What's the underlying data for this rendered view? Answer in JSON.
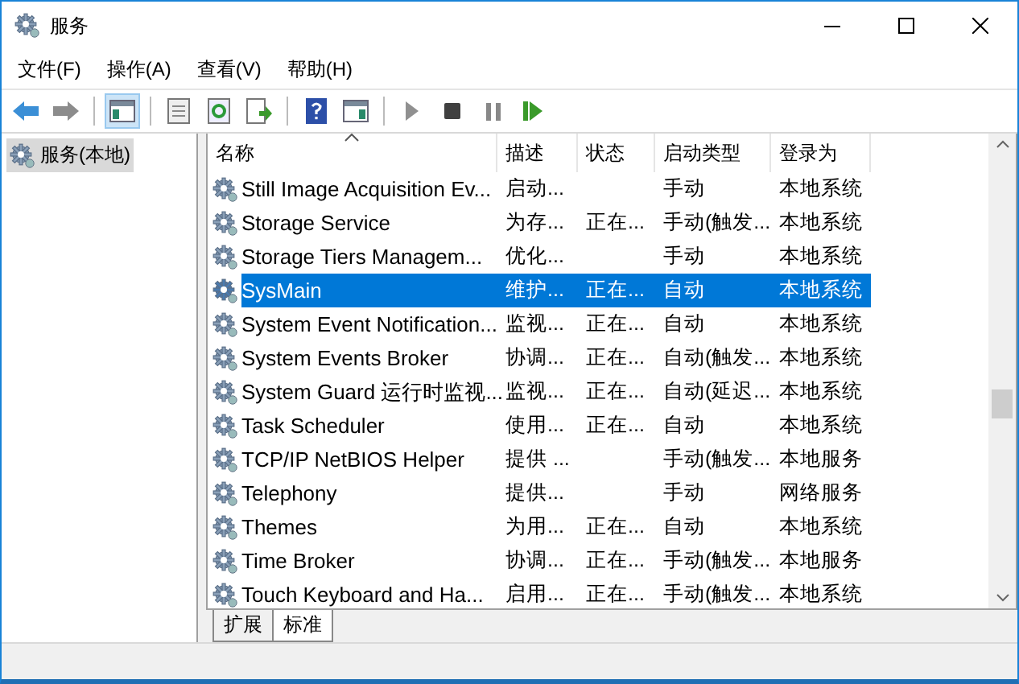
{
  "window": {
    "title": "服务"
  },
  "menu": [
    "文件(F)",
    "操作(A)",
    "查看(V)",
    "帮助(H)"
  ],
  "toolbar": [
    {
      "kind": "back",
      "pressed": false
    },
    {
      "kind": "forward",
      "pressed": false
    },
    {
      "kind": "sep"
    },
    {
      "kind": "tree",
      "pressed": true
    },
    {
      "kind": "sep"
    },
    {
      "kind": "properties",
      "pressed": false
    },
    {
      "kind": "refresh",
      "pressed": false
    },
    {
      "kind": "export",
      "pressed": false
    },
    {
      "kind": "sep"
    },
    {
      "kind": "help",
      "pressed": false
    },
    {
      "kind": "pane",
      "pressed": false
    },
    {
      "kind": "sep"
    },
    {
      "kind": "play",
      "pressed": false
    },
    {
      "kind": "stop",
      "pressed": false
    },
    {
      "kind": "pause",
      "pressed": false
    },
    {
      "kind": "resume",
      "pressed": false
    }
  ],
  "sidebar": {
    "items": [
      {
        "label": "服务(本地)",
        "selected": true
      }
    ]
  },
  "table": {
    "columns": [
      "名称",
      "描述",
      "状态",
      "启动类型",
      "登录为"
    ],
    "rows": [
      {
        "name": "Still Image Acquisition Ev...",
        "description": "启动...",
        "status": "",
        "startup": "手动",
        "logon": "本地系统",
        "selected": false
      },
      {
        "name": "Storage Service",
        "description": "为存...",
        "status": "正在...",
        "startup": "手动(触发...",
        "logon": "本地系统",
        "selected": false
      },
      {
        "name": "Storage Tiers Managem...",
        "description": "优化...",
        "status": "",
        "startup": "手动",
        "logon": "本地系统",
        "selected": false
      },
      {
        "name": "SysMain",
        "description": "维护...",
        "status": "正在...",
        "startup": "自动",
        "logon": "本地系统",
        "selected": true
      },
      {
        "name": "System Event Notification...",
        "description": "监视...",
        "status": "正在...",
        "startup": "自动",
        "logon": "本地系统",
        "selected": false
      },
      {
        "name": "System Events Broker",
        "description": "协调...",
        "status": "正在...",
        "startup": "自动(触发...",
        "logon": "本地系统",
        "selected": false
      },
      {
        "name": "System Guard 运行时监视...",
        "description": "监视...",
        "status": "正在...",
        "startup": "自动(延迟...",
        "logon": "本地系统",
        "selected": false
      },
      {
        "name": "Task Scheduler",
        "description": "使用...",
        "status": "正在...",
        "startup": "自动",
        "logon": "本地系统",
        "selected": false
      },
      {
        "name": "TCP/IP NetBIOS Helper",
        "description": "提供 ...",
        "status": "",
        "startup": "手动(触发...",
        "logon": "本地服务",
        "selected": false
      },
      {
        "name": "Telephony",
        "description": "提供...",
        "status": "",
        "startup": "手动",
        "logon": "网络服务",
        "selected": false
      },
      {
        "name": "Themes",
        "description": "为用...",
        "status": "正在...",
        "startup": "自动",
        "logon": "本地系统",
        "selected": false
      },
      {
        "name": "Time Broker",
        "description": "协调...",
        "status": "正在...",
        "startup": "手动(触发...",
        "logon": "本地服务",
        "selected": false
      },
      {
        "name": "Touch Keyboard and Ha...",
        "description": "启用...",
        "status": "正在...",
        "startup": "手动(触发...",
        "logon": "本地系统",
        "selected": false
      }
    ]
  },
  "view_tabs": [
    {
      "label": "扩展",
      "selected": false
    },
    {
      "label": "标准",
      "selected": true
    }
  ]
}
